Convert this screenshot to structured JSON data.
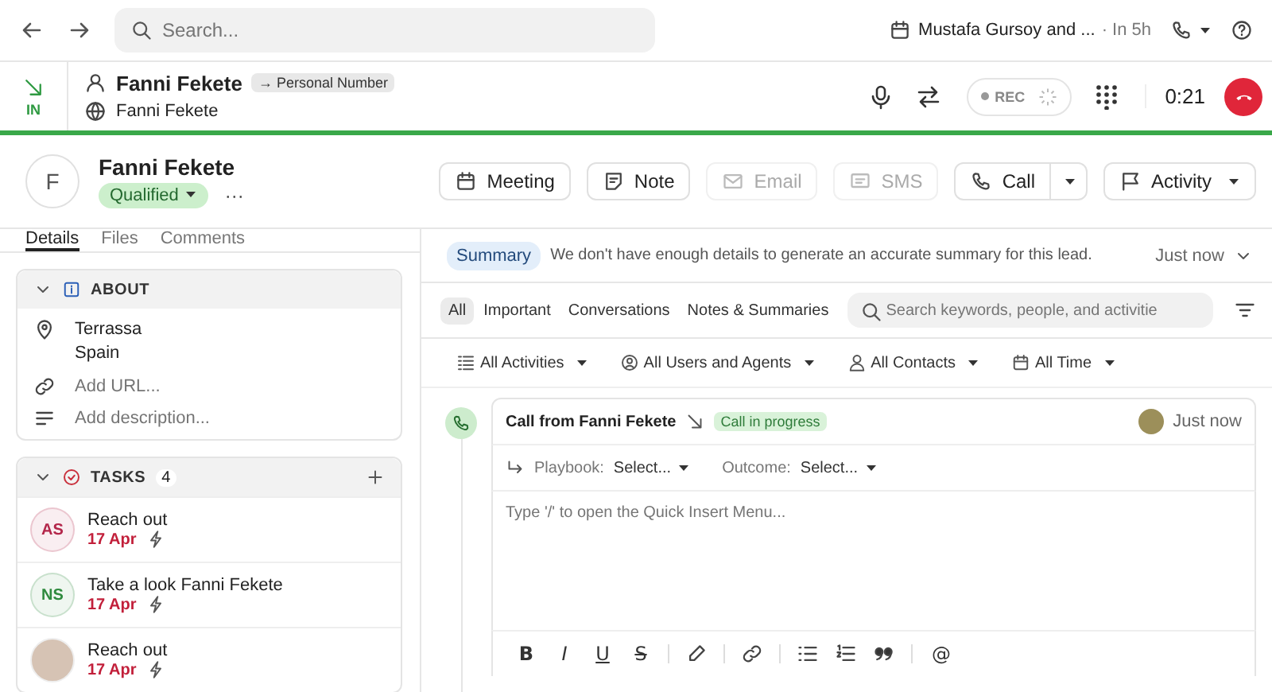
{
  "top_bar": {
    "search": {
      "placeholder": "Search..."
    },
    "meeting": {
      "title": "Mustafa Gursoy and ...",
      "time": "· In 5h"
    }
  },
  "call_bar": {
    "direction": "IN",
    "name": "Fanni Fekete",
    "number_tag": "→ Personal Number",
    "company": "Fanni Fekete",
    "rec": "REC",
    "timer": "0:21"
  },
  "contact": {
    "initial": "F",
    "name": "Fanni Fekete",
    "status": "Qualified",
    "more": "···"
  },
  "actions": [
    {
      "label": "Meeting",
      "kind": "meeting",
      "disabled": false
    },
    {
      "label": "Note",
      "kind": "note",
      "disabled": false
    },
    {
      "label": "Email",
      "kind": "email",
      "disabled": true
    },
    {
      "label": "SMS",
      "kind": "sms",
      "disabled": true
    },
    {
      "label": "Call",
      "kind": "call",
      "disabled": false
    },
    {
      "label": "Activity",
      "kind": "activity",
      "disabled": false
    }
  ],
  "left_tabs": [
    {
      "label": "Details",
      "selected": true
    },
    {
      "label": "Files",
      "selected": false
    },
    {
      "label": "Comments",
      "selected": false
    }
  ],
  "about": {
    "title": "ABOUT",
    "location": [
      "Terrassa",
      "Spain"
    ],
    "url_placeholder": "Add URL...",
    "description_placeholder": "Add description..."
  },
  "tasks": {
    "title": "TASKS",
    "count": "4",
    "items": [
      {
        "title": "Reach out",
        "date": "17 Apr",
        "initials": "AS",
        "color": "#b3264a",
        "kind": "initials"
      },
      {
        "title": "Take a look Fanni Fekete",
        "date": "17 Apr",
        "initials": "NS",
        "color": "#2f8a3e",
        "kind": "initials"
      },
      {
        "title": "Reach out",
        "date": "17 Apr",
        "kind": "photo"
      }
    ]
  },
  "summary": {
    "label": "Summary",
    "text": "We don't have enough details to generate an accurate summary for this lead.",
    "time": "Just now"
  },
  "feed_tabs": [
    {
      "label": "All",
      "selected": true
    },
    {
      "label": "Important",
      "selected": false
    },
    {
      "label": "Conversations",
      "selected": false
    },
    {
      "label": "Notes & Summaries",
      "selected": false
    }
  ],
  "feed_search": {
    "placeholder": "Search keywords, people, and activitie"
  },
  "filters": [
    {
      "label": "All Activities",
      "kind": "activities"
    },
    {
      "label": "All Users and Agents",
      "kind": "users"
    },
    {
      "label": "All Contacts",
      "kind": "contacts"
    },
    {
      "label": "All Time",
      "kind": "time"
    }
  ],
  "call_card": {
    "title": "Call from Fanni Fekete",
    "status": "Call in progress",
    "time": "Just now",
    "playbook_label": "Playbook:",
    "playbook_value": "Select...",
    "outcome_label": "Outcome:",
    "outcome_value": "Select...",
    "placeholder": "Type '/' to open the Quick Insert Menu...",
    "toolbar": [
      {
        "kind": "bold",
        "label": "B"
      },
      {
        "kind": "italic",
        "label": "I"
      },
      {
        "kind": "underline",
        "label": "U"
      },
      {
        "kind": "strike",
        "label": "S"
      },
      {
        "kind": "sep"
      },
      {
        "kind": "highlight"
      },
      {
        "kind": "sep"
      },
      {
        "kind": "link"
      },
      {
        "kind": "sep"
      },
      {
        "kind": "bullets"
      },
      {
        "kind": "numbers"
      },
      {
        "kind": "quote"
      },
      {
        "kind": "sep"
      },
      {
        "kind": "mention",
        "label": "@"
      }
    ]
  }
}
